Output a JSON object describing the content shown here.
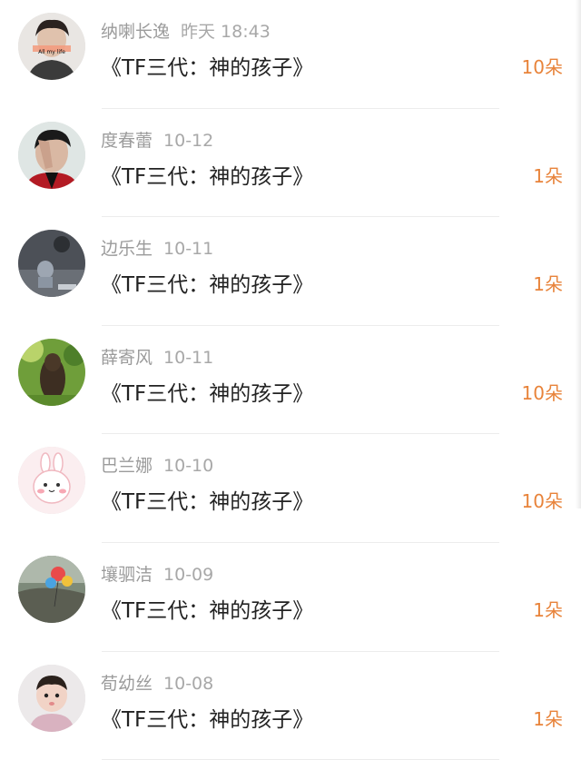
{
  "gifts": [
    {
      "name": "纳喇长逸",
      "time": "昨天 18:43",
      "title": "《TF三代：神的孩子》",
      "count": "10朵",
      "avatar_caption": "All my life",
      "avatar": "avatar-teen-boy"
    },
    {
      "name": "度春蕾",
      "time": "10-12",
      "title": "《TF三代：神的孩子》",
      "count": "1朵",
      "avatar": "avatar-man-hand-over-face"
    },
    {
      "name": "边乐生",
      "time": "10-11",
      "title": "《TF三代：神的孩子》",
      "count": "1朵",
      "avatar": "avatar-dark-room"
    },
    {
      "name": "薛寄风",
      "time": "10-11",
      "title": "《TF三代：神的孩子》",
      "count": "10朵",
      "avatar": "avatar-girl-back-green"
    },
    {
      "name": "巴兰娜",
      "time": "10-10",
      "title": "《TF三代：神的孩子》",
      "count": "10朵",
      "avatar": "avatar-cartoon-bunny"
    },
    {
      "name": "壤驷洁",
      "time": "10-09",
      "title": "《TF三代：神的孩子》",
      "count": "1朵",
      "avatar": "avatar-balloons"
    },
    {
      "name": "荀幼丝",
      "time": "10-08",
      "title": "《TF三代：神的孩子》",
      "count": "1朵",
      "avatar": "avatar-baby"
    }
  ],
  "colors": {
    "accent": "#e8833a",
    "name_text": "#9b9b9b",
    "title_text": "#222222"
  }
}
